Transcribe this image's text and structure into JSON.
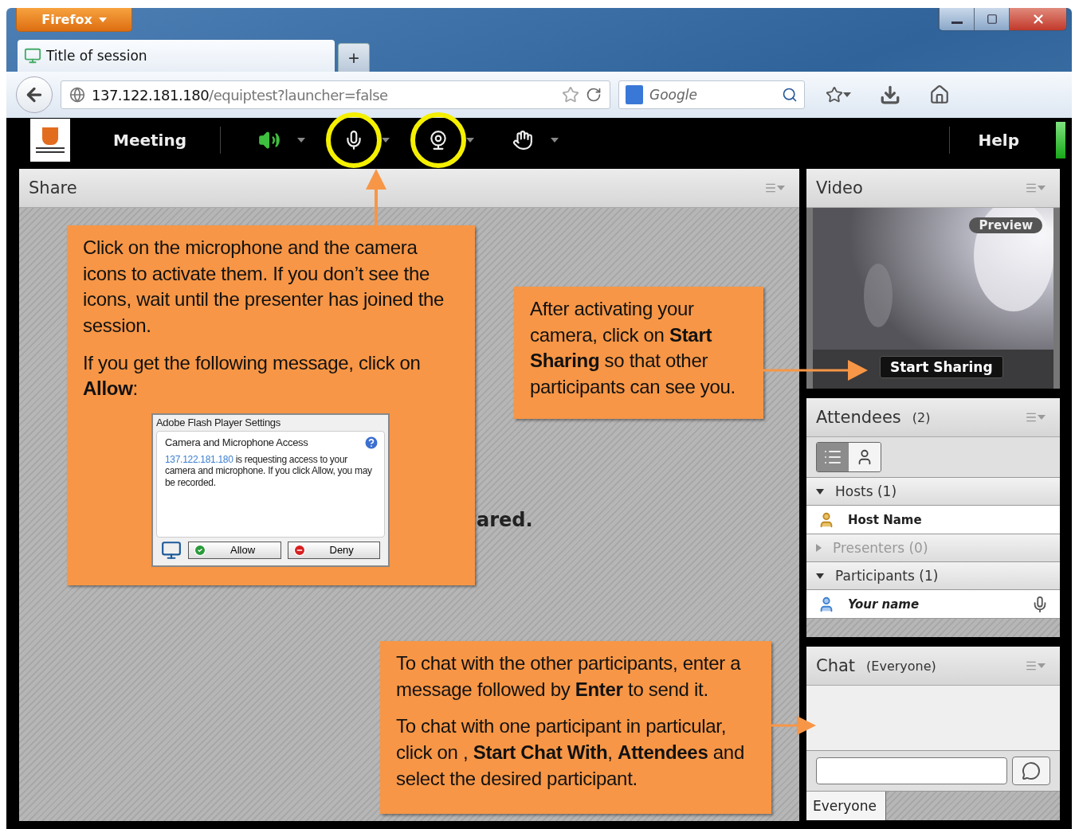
{
  "browser": {
    "menu_button": "Firefox",
    "tab_title": "Title of session",
    "new_tab": "+",
    "url_host": "137.122.181.180",
    "url_path": "/equiptest?launcher=false",
    "search_placeholder": "Google"
  },
  "app_bar": {
    "menu": "Meeting",
    "help": "Help",
    "tools": [
      {
        "kind": "speaker",
        "highlighted": false
      },
      {
        "kind": "microphone",
        "highlighted": true
      },
      {
        "kind": "camera",
        "highlighted": true
      },
      {
        "kind": "hand",
        "highlighted": false
      }
    ]
  },
  "share": {
    "title": "Share",
    "message": "ared."
  },
  "video": {
    "title": "Video",
    "badge": "Preview",
    "button": "Start Sharing"
  },
  "attendees": {
    "title": "Attendees",
    "count": "(2)",
    "view_modes": [
      {
        "kind": "list",
        "selected": true
      },
      {
        "kind": "people",
        "selected": false
      }
    ],
    "groups": [
      {
        "label": "Hosts (1)",
        "expanded": true,
        "disabled": false,
        "members": [
          {
            "name": "Host Name",
            "kind": "host",
            "italic": false,
            "mic": false
          }
        ]
      },
      {
        "label": "Presenters (0)",
        "expanded": false,
        "disabled": true
      },
      {
        "label": "Participants (1)",
        "expanded": true,
        "disabled": false,
        "members": [
          {
            "name": "Your name",
            "kind": "participant",
            "italic": true,
            "mic": true
          }
        ]
      }
    ]
  },
  "chat": {
    "title": "Chat",
    "scope": "(Everyone)",
    "tab": "Everyone"
  },
  "callouts": [
    {
      "kind": "share",
      "paragraphs": [
        "Click on the microphone and the camera icons to activate them. If you don’t see the icons, wait until the presenter has joined the session.",
        "If you get the following message, click on **Allow**:"
      ],
      "dialog": {
        "title": "Adobe Flash Player Settings",
        "heading": "Camera and Microphone Access",
        "host": "137.122.181.180",
        "message": " is requesting access to your camera and microphone. If you click Allow, you may be recorded.",
        "allow": "Allow",
        "deny": "Deny"
      }
    },
    {
      "kind": "video",
      "paragraphs": [
        "After activating your camera, click on **Start Sharing** so that other participants can see you."
      ]
    },
    {
      "kind": "chat",
      "paragraphs": [
        "To chat with the other participants, enter a message followed by **Enter** to send it.",
        "To chat with one participant in particular, click on , **Start Chat With**, **Attendees** and select the desired participant."
      ]
    }
  ]
}
